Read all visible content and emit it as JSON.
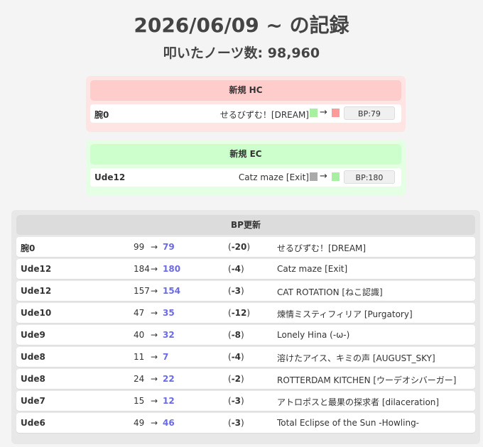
{
  "header": {
    "title": "2026/06/09 ~ の記録",
    "notes_label": "叩いたノーツ数:",
    "notes_count": "98,960"
  },
  "hc": {
    "title": "新規 HC",
    "row": {
      "level": "腕0",
      "song": "せるびずむ！[DREAM]",
      "arrow": "→",
      "bp": "BP:79",
      "from_color": "#a6f0a0",
      "to_color": "#ff9a9a"
    }
  },
  "ec": {
    "title": "新規 EC",
    "row": {
      "level": "Ude12",
      "song": "Catz maze [Exit]",
      "arrow": "→",
      "bp": "BP:180",
      "from_color": "#aaaaaa",
      "to_color": "#a6f0a0"
    }
  },
  "bp_update": {
    "title": "BP更新",
    "arrow": "→",
    "rows": [
      {
        "level": "腕0",
        "old": "99",
        "new": "79",
        "diff": "-20",
        "song": "せるびずむ！[DREAM]"
      },
      {
        "level": "Ude12",
        "old": "184",
        "new": "180",
        "diff": "-4",
        "song": "Catz maze [Exit]"
      },
      {
        "level": "Ude12",
        "old": "157",
        "new": "154",
        "diff": "-3",
        "song": "CAT ROTATION [ねこ認識]"
      },
      {
        "level": "Ude10",
        "old": "47",
        "new": "35",
        "diff": "-12",
        "song": "煉情ミスティフィリア [Purgatory]"
      },
      {
        "level": "Ude9",
        "old": "40",
        "new": "32",
        "diff": "-8",
        "song": "Lonely Hina (-ω-)"
      },
      {
        "level": "Ude8",
        "old": "11",
        "new": "7",
        "diff": "-4",
        "song": "溶けたアイス、キミの声 [AUGUST_SKY]"
      },
      {
        "level": "Ude8",
        "old": "24",
        "new": "22",
        "diff": "-2",
        "song": "ROTTERDAM KITCHEN [ウーデオシバーガー]"
      },
      {
        "level": "Ude7",
        "old": "15",
        "new": "12",
        "diff": "-3",
        "song": "アトロポスと最果の探求者 [dilaceration]"
      },
      {
        "level": "Ude6",
        "old": "49",
        "new": "46",
        "diff": "-3",
        "song": "Total Eclipse of the Sun -Howling-"
      }
    ]
  }
}
